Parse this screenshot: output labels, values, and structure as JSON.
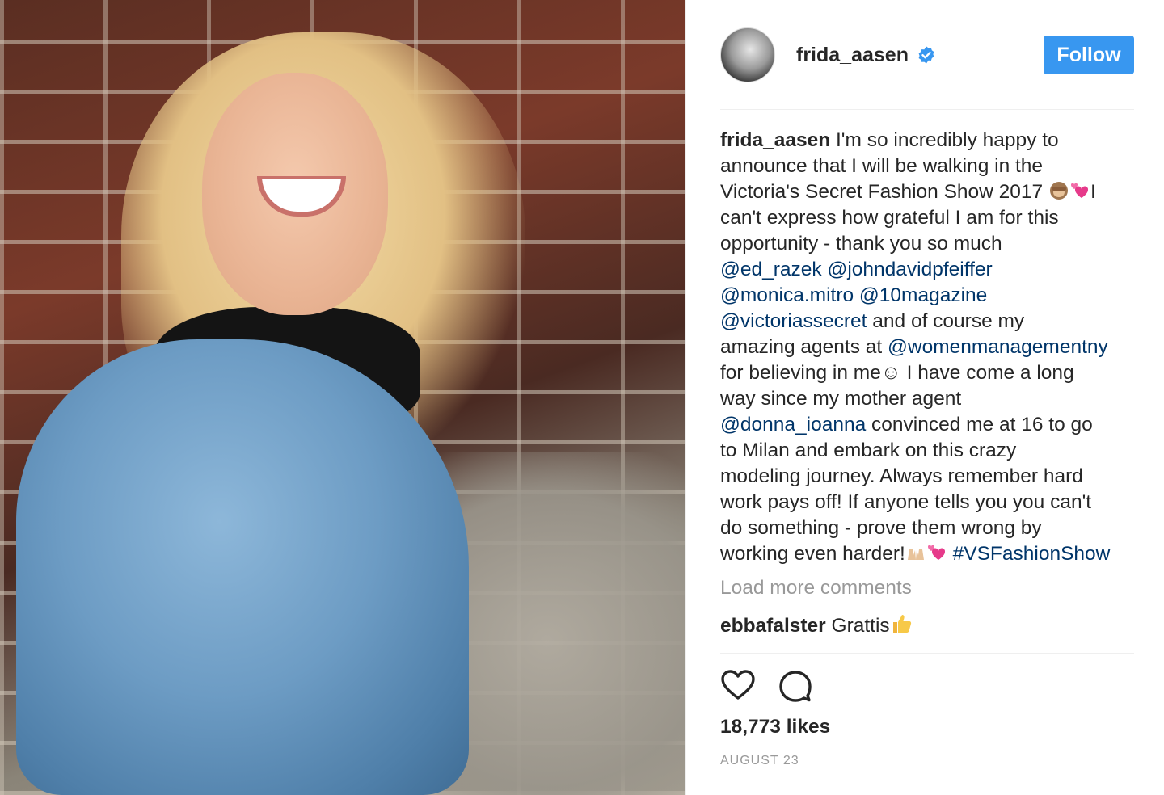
{
  "post": {
    "username": "frida_aasen",
    "follow_label": "Follow",
    "caption_lines": [
      {
        "bold": "frida_aasen",
        "text": " I'm so incredibly happy to"
      },
      {
        "text": "announce that I will be walking in the"
      },
      {
        "text": "Victoria's Secret Fashion Show 2017 ",
        "emoji_after": true,
        "tail": "I"
      },
      {
        "text": "can't express how grateful I am for this"
      },
      {
        "text": "opportunity - thank you so much"
      },
      {
        "mentions": [
          "@ed_razek",
          "@johndavidpfeiffer"
        ]
      },
      {
        "mentions": [
          "@monica.mitro",
          "@10magazine"
        ]
      },
      {
        "mention": "@victoriassecret",
        "text": " and of course my"
      },
      {
        "text": "amazing agents at ",
        "mention": "@womenmanagementny"
      },
      {
        "text": "for believing in me",
        "smiley": "☺",
        "tail": " I have come a long"
      },
      {
        "text": "way since my mother agent"
      },
      {
        "mention": "@donna_ioanna",
        "text": " convinced me at 16 to go"
      },
      {
        "text": "to Milan and embark on this crazy"
      },
      {
        "text": "modeling journey. Always remember hard"
      },
      {
        "text": "work pays off! If anyone tells you you can't"
      },
      {
        "text": "do something - prove them wrong by"
      },
      {
        "text": "working even harder!",
        "hashtag": "#VSFashionShow"
      }
    ],
    "load_more": "Load more comments",
    "comment": {
      "user": "ebbafalster",
      "text": " Grattis"
    },
    "likes": "18,773 likes",
    "date": "AUGUST 23"
  },
  "colors": {
    "follow": "#3897f0",
    "link": "#003569",
    "muted": "#999999",
    "text": "#262626"
  },
  "icons": [
    "verified-badge-icon",
    "see-no-evil-monkey-emoji-icon",
    "two-hearts-emoji-icon",
    "raising-hands-emoji-icon",
    "thumbs-up-emoji-icon",
    "heart-icon",
    "comment-icon"
  ]
}
